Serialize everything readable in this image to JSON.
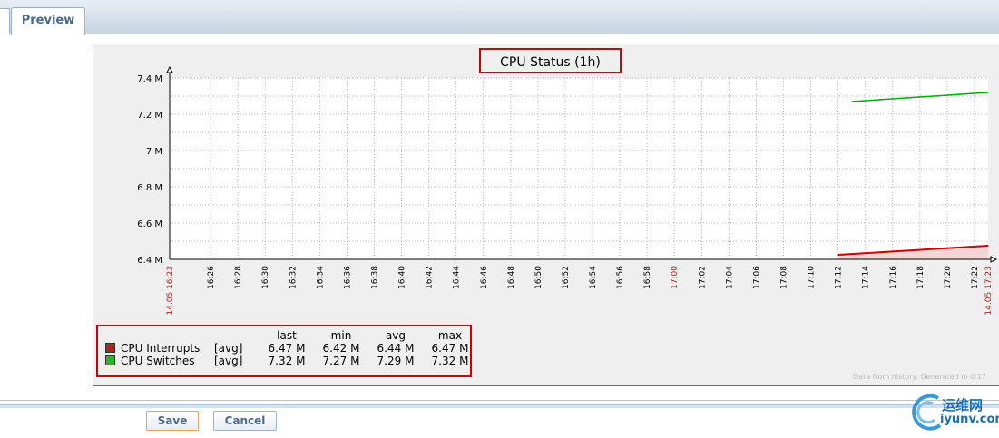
{
  "tabs": {
    "preview": "Preview"
  },
  "graph": {
    "title": "CPU Status (1h)",
    "footnote": "Data from history. Generated in 0.17"
  },
  "chart_data": {
    "type": "line",
    "title": "CPU Status (1h)",
    "y_ticks": [
      "6.4 M",
      "6.6 M",
      "6.8 M",
      "7 M",
      "7.2 M",
      "7.4 M"
    ],
    "ylim": [
      6400000,
      7400000
    ],
    "x_tick_labels": [
      "16:26",
      "16:28",
      "16:30",
      "16:32",
      "16:34",
      "16:36",
      "16:38",
      "16:40",
      "16:42",
      "16:44",
      "16:46",
      "16:48",
      "16:50",
      "16:52",
      "16:54",
      "16:56",
      "16:58",
      "17:00",
      "17:02",
      "17:04",
      "17:06",
      "17:08",
      "17:10",
      "17:12",
      "17:14",
      "17:16",
      "17:18",
      "17:20",
      "17:22"
    ],
    "x_edge_labels": {
      "start": "14.05 16:23",
      "end": "14.05 17:23"
    },
    "xlim": [
      "16:23",
      "17:23"
    ],
    "grid": true,
    "series": [
      {
        "name": "CPU Interrupts",
        "style": "filled",
        "color": "#cc0000",
        "fill_color": "#f6d4d4",
        "x": [
          "17:12",
          "17:23"
        ],
        "values": [
          6425000,
          6475000
        ]
      },
      {
        "name": "CPU Switches",
        "style": "line",
        "color": "#00aa00",
        "x": [
          "17:13",
          "17:23"
        ],
        "values": [
          7270000,
          7320000
        ]
      }
    ]
  },
  "legend": {
    "headers": {
      "last": "last",
      "min": "min",
      "avg": "avg",
      "max": "max"
    },
    "rows": [
      {
        "name": "CPU Interrupts",
        "func": "[avg]",
        "last": "6.47 M",
        "min": "6.42 M",
        "avg": "6.44 M",
        "max": "6.47 M",
        "color": "#b22222"
      },
      {
        "name": "CPU Switches",
        "func": "[avg]",
        "last": "7.32 M",
        "min": "7.27 M",
        "avg": "7.29 M",
        "max": "7.32 M",
        "color": "#22bb22"
      }
    ]
  },
  "buttons": {
    "save": "Save",
    "cancel": "Cancel"
  },
  "watermark": {
    "zh": "运维网",
    "en": "iyunv.com"
  }
}
